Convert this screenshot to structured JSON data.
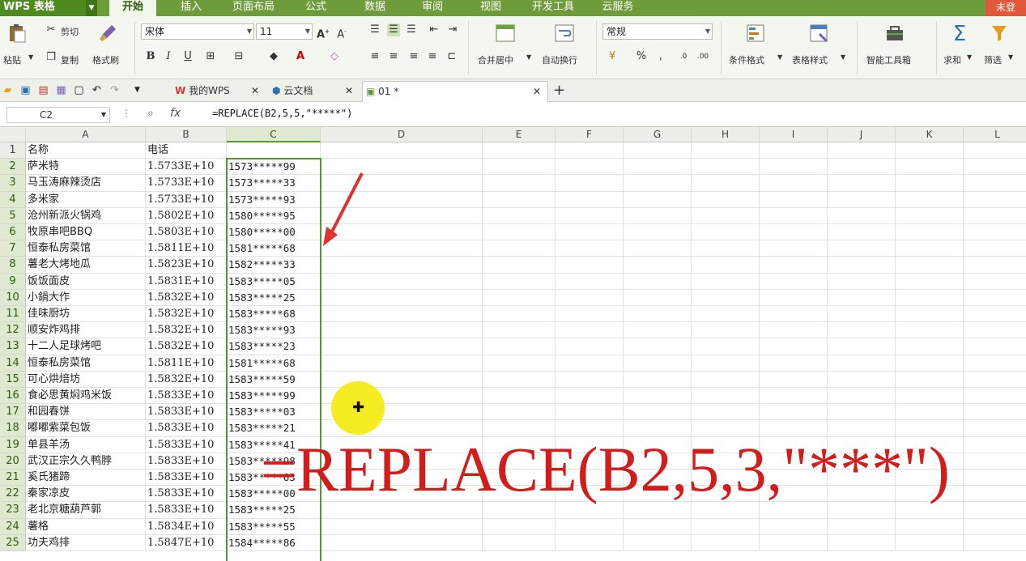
{
  "menubar": {
    "app_title": "WPS 表格",
    "tabs": [
      "开始",
      "插入",
      "页面布局",
      "公式",
      "数据",
      "审阅",
      "视图",
      "开发工具",
      "云服务"
    ],
    "active_tab": "开始",
    "user": "未登"
  },
  "ribbon": {
    "paste": "粘贴",
    "cut": "剪切",
    "copy": "复制",
    "format_painter": "格式刷",
    "font_name": "宋体",
    "font_size": "11",
    "merge_center": "合并居中",
    "wrap_text": "自动换行",
    "number_format": "常规",
    "percent": "%",
    "conditional_format": "条件格式",
    "table_style": "表格样式",
    "smart_tools": "智能工具箱",
    "sum": "求和",
    "filter": "筛选"
  },
  "doc_tabs": {
    "tabs": [
      {
        "label": "我的WPS"
      },
      {
        "label": "云文档"
      },
      {
        "label": "01 *"
      }
    ],
    "add": "+"
  },
  "formula_bar": {
    "cell_ref": "C2",
    "fx": "fx",
    "formula": "=REPLACE(B2,5,5,\"*****\")"
  },
  "grid": {
    "columns": [
      "A",
      "B",
      "C",
      "D",
      "E",
      "F",
      "G",
      "H",
      "I",
      "J",
      "K",
      "L"
    ],
    "rows": [
      {
        "n": "1",
        "a": "名称",
        "b": "电话",
        "c": ""
      },
      {
        "n": "2",
        "a": "萨米特",
        "b": "1.5733E+10",
        "c": "1573*****99"
      },
      {
        "n": "3",
        "a": "马玉涛麻辣烫店",
        "b": "1.5733E+10",
        "c": "1573*****33"
      },
      {
        "n": "4",
        "a": "多米家",
        "b": "1.5733E+10",
        "c": "1573*****93"
      },
      {
        "n": "5",
        "a": "沧州新派火锅鸡",
        "b": "1.5802E+10",
        "c": "1580*****95"
      },
      {
        "n": "6",
        "a": "牧原串吧BBQ",
        "b": "1.5803E+10",
        "c": "1580*****00"
      },
      {
        "n": "7",
        "a": "恒泰私房菜馆",
        "b": "1.5811E+10",
        "c": "1581*****68"
      },
      {
        "n": "8",
        "a": "薯老大烤地瓜",
        "b": "1.5823E+10",
        "c": "1582*****33"
      },
      {
        "n": "9",
        "a": "饭饭面皮",
        "b": "1.5831E+10",
        "c": "1583*****05"
      },
      {
        "n": "10",
        "a": "小鍋大作",
        "b": "1.5832E+10",
        "c": "1583*****25"
      },
      {
        "n": "11",
        "a": "佳味厨坊",
        "b": "1.5832E+10",
        "c": "1583*****68"
      },
      {
        "n": "12",
        "a": "顺安炸鸡排",
        "b": "1.5832E+10",
        "c": "1583*****93"
      },
      {
        "n": "13",
        "a": "十二人足球烤吧",
        "b": "1.5832E+10",
        "c": "1583*****23"
      },
      {
        "n": "14",
        "a": "恒泰私房菜馆",
        "b": "1.5811E+10",
        "c": "1581*****68"
      },
      {
        "n": "15",
        "a": "可心烘焙坊",
        "b": "1.5832E+10",
        "c": "1583*****59"
      },
      {
        "n": "16",
        "a": "食必思黄焖鸡米饭",
        "b": "1.5833E+10",
        "c": "1583*****99"
      },
      {
        "n": "17",
        "a": "和园春饼",
        "b": "1.5833E+10",
        "c": "1583*****03"
      },
      {
        "n": "18",
        "a": "嘟嘟紫菜包饭",
        "b": "1.5833E+10",
        "c": "1583*****21"
      },
      {
        "n": "19",
        "a": "单县羊汤",
        "b": "1.5833E+10",
        "c": "1583*****41"
      },
      {
        "n": "20",
        "a": "武汉正宗久久鸭脖",
        "b": "1.5833E+10",
        "c": "1583*****98"
      },
      {
        "n": "21",
        "a": "奚氏猪蹄",
        "b": "1.5833E+10",
        "c": "1583*****63"
      },
      {
        "n": "22",
        "a": "秦家凉皮",
        "b": "1.5833E+10",
        "c": "1583*****00"
      },
      {
        "n": "23",
        "a": "老北京糖葫芦郭",
        "b": "1.5833E+10",
        "c": "1583*****25"
      },
      {
        "n": "24",
        "a": "薯格",
        "b": "1.5834E+10",
        "c": "1583*****55"
      },
      {
        "n": "25",
        "a": "功夫鸡排",
        "b": "1.5847E+10",
        "c": "1584*****86"
      }
    ]
  },
  "overlay": {
    "annotation": "=REPLACE(B2,5,3,\"***\")"
  },
  "colors": {
    "menubar": "#6e9c3a",
    "selection": "#4f9a2c",
    "annotation": "#d21d1d",
    "cursor_highlight": "#f5ec16"
  }
}
